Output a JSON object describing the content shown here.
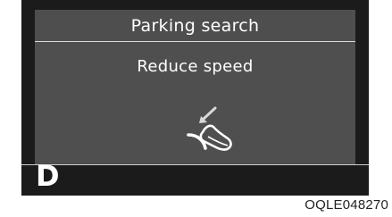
{
  "display": {
    "title": "Parking search",
    "message": "Reduce speed",
    "gear": "D",
    "icon": "foot-on-brake-icon"
  },
  "figure_code": "OQLE048270",
  "colors": {
    "cluster_background": "#1b1b1b",
    "title_bar": "#4e4e4e",
    "panel": "#4f4f4f",
    "text": "#ffffff"
  }
}
